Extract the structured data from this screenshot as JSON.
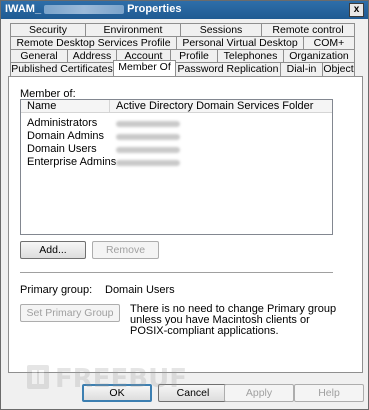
{
  "window": {
    "title_prefix": "IWAM_",
    "title_suffix": "Properties",
    "close_label": "x"
  },
  "tabs": {
    "row1": [
      "Security",
      "Environment",
      "Sessions",
      "Remote control"
    ],
    "row2": [
      "Remote Desktop Services Profile",
      "Personal Virtual Desktop",
      "COM+"
    ],
    "row3": [
      "General",
      "Address",
      "Account",
      "Profile",
      "Telephones",
      "Organization"
    ],
    "row4": [
      "Published Certificates",
      "Member Of",
      "Password Replication",
      "Dial-in",
      "Object"
    ],
    "active": "Member Of"
  },
  "member_of": {
    "label": "Member of:",
    "columns": [
      "Name",
      "Active Directory Domain Services Folder"
    ],
    "rows": [
      {
        "name": "Administrators"
      },
      {
        "name": "Domain Admins"
      },
      {
        "name": "Domain Users"
      },
      {
        "name": "Enterprise Admins"
      }
    ],
    "add_label": "Add...",
    "remove_label": "Remove"
  },
  "primary_group": {
    "label": "Primary group:",
    "value": "Domain Users",
    "set_button_label": "Set Primary Group",
    "note": "There is no need to change Primary group unless you have Macintosh clients or POSIX-compliant applications."
  },
  "footer": {
    "ok_label": "OK",
    "cancel_label": "Cancel",
    "apply_label": "Apply",
    "help_label": "Help"
  },
  "watermark_text": "FREEBUF"
}
